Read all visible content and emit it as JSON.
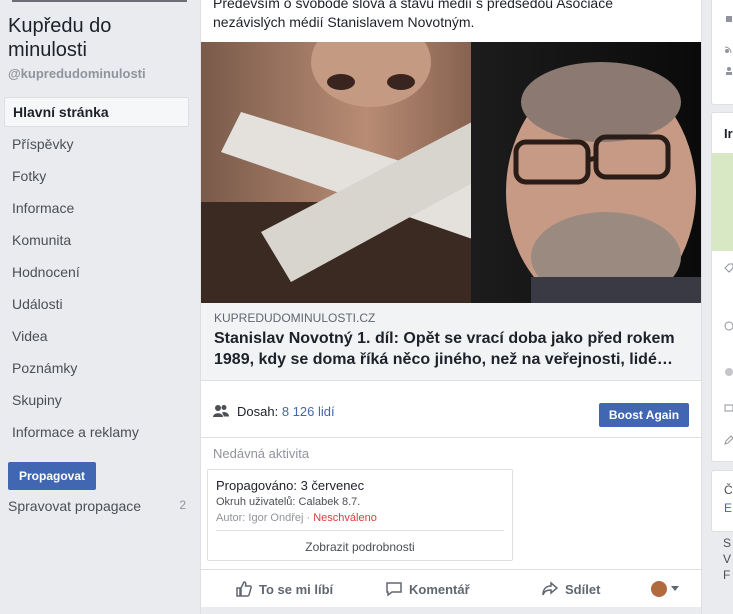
{
  "sidebar": {
    "page_name": "Kupředu do minulosti",
    "page_handle": "@kupredudominulosti",
    "nav_items": [
      {
        "label": "Hlavní stránka",
        "active": true
      },
      {
        "label": "Příspěvky"
      },
      {
        "label": "Fotky"
      },
      {
        "label": "Informace"
      },
      {
        "label": "Komunita"
      },
      {
        "label": "Hodnocení"
      },
      {
        "label": "Události"
      },
      {
        "label": "Videa"
      },
      {
        "label": "Poznámky"
      },
      {
        "label": "Skupiny"
      },
      {
        "label": "Informace a reklamy"
      }
    ],
    "promote_label": "Propagovat",
    "manage_promotions_label": "Spravovat propagace",
    "manage_promotions_count": "2"
  },
  "post": {
    "text": "Především o svobodě slova a stavu médií s předsedou Asociace nezávislých médií Stanislavem Novotným.",
    "link": {
      "domain": "KUPREDUDOMINULOSTI.CZ",
      "title": "Stanislav Novotný 1. díl: Opět se vrací doba jako před rokem 1989, kdy se doma říká něco jiného, než na veřejnosti, lidé…"
    },
    "reach": {
      "label": "Dosah:",
      "value": "8 126 lidí"
    },
    "boost_label": "Boost Again",
    "recent_activity_label": "Nedávná aktivita",
    "activity": {
      "title": "Propagováno: 3 červenec",
      "audience": "Okruh uživatelů: Calabek 8.7.",
      "author": "Autor: Igor Ondřej",
      "separator": "·",
      "status": "Neschváleno",
      "details_link": "Zobrazit podrobnosti"
    },
    "actions": {
      "like": "To se mi líbí",
      "comment": "Komentář",
      "share": "Sdílet"
    }
  },
  "right_column": {
    "header_partial": "Ir",
    "text_partial_1": "Č",
    "link_partial": "E",
    "text_partial_2": "S",
    "text_partial_3": "V",
    "text_partial_4": "F"
  },
  "colors": {
    "accent": "#4267b2",
    "status_rejected": "#e0393e",
    "background": "#e9ebee"
  }
}
